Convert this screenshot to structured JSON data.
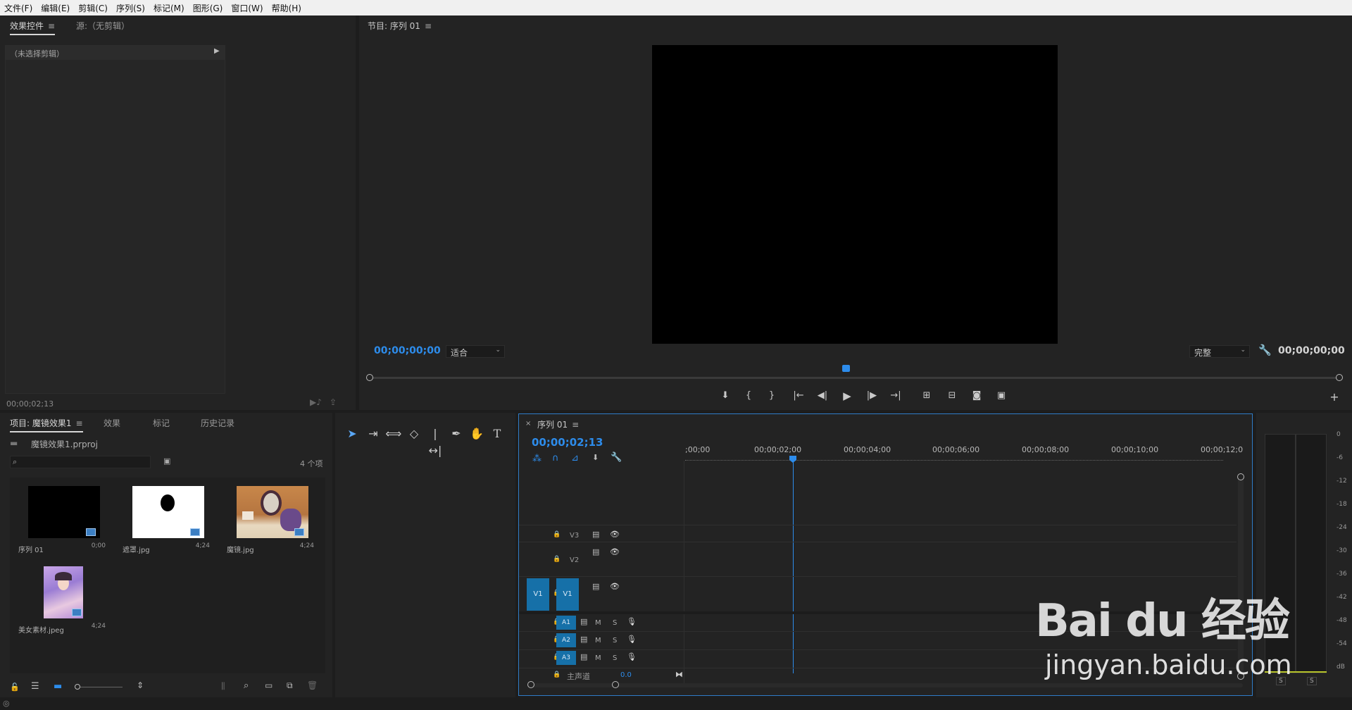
{
  "menu": [
    "文件(F)",
    "编辑(E)",
    "剪辑(C)",
    "序列(S)",
    "标记(M)",
    "图形(G)",
    "窗口(W)",
    "帮助(H)"
  ],
  "effect_controls": {
    "tab_active": "效果控件",
    "tab_source": "源:（无剪辑）",
    "no_clip": "（未选择剪辑）",
    "timecode": "00;00;02;13"
  },
  "program_monitor": {
    "title": "节目: 序列 01",
    "timecode_left": "00;00;00;00",
    "zoom": "适合",
    "quality": "完整",
    "timecode_right": "00;00;00;00"
  },
  "project": {
    "tabs": [
      "项目: 魔镜效果1",
      "效果",
      "标记",
      "历史记录"
    ],
    "file": "魔镜效果1.prproj",
    "count": "4 个项",
    "items": [
      {
        "name": "序列 01",
        "dur": "0;00"
      },
      {
        "name": "遮罩.jpg",
        "dur": "4;24"
      },
      {
        "name": "魔镜.jpg",
        "dur": "4;24"
      },
      {
        "name": "美女素材.jpeg",
        "dur": "4;24"
      }
    ]
  },
  "timeline": {
    "title": "序列 01",
    "timecode": "00;00;02;13",
    "ruler": [
      ";00;00",
      "00;00;02;00",
      "00;00;04;00",
      "00;00;06;00",
      "00;00;08;00",
      "00;00;10;00",
      "00;00;12;0"
    ],
    "video_tracks": [
      "V3",
      "V2",
      "V1"
    ],
    "audio_tracks": [
      "A1",
      "A2",
      "A3"
    ],
    "source_v": "V1",
    "master_label": "主声道",
    "master_value": "0.0",
    "m_label": "M",
    "s_label": "S"
  },
  "meter": {
    "scale": [
      "0",
      "-6",
      "-12",
      "-18",
      "-24",
      "-30",
      "-36",
      "-42",
      "-48",
      "-54",
      "dB"
    ],
    "s_buttons": [
      "S",
      "S"
    ]
  },
  "watermark": {
    "logo": "Bai du 经验",
    "url": "jingyan.baidu.com"
  },
  "colors": {
    "accent": "#2d8ceb",
    "track_blue": "#1670a8",
    "panel": "#232323"
  }
}
